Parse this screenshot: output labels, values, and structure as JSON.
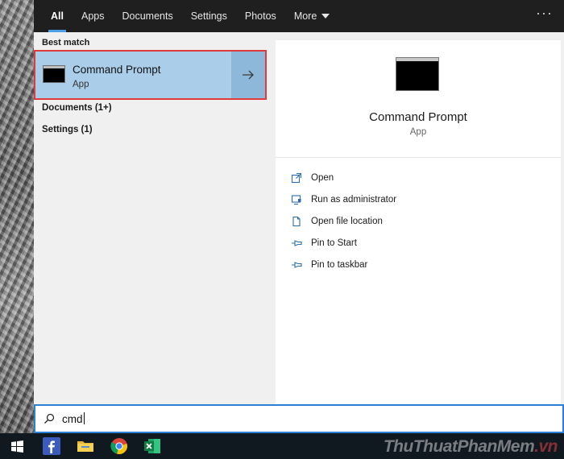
{
  "tabs": [
    {
      "label": "All",
      "active": true
    },
    {
      "label": "Apps",
      "active": false
    },
    {
      "label": "Documents",
      "active": false
    },
    {
      "label": "Settings",
      "active": false
    },
    {
      "label": "Photos",
      "active": false
    },
    {
      "label": "More",
      "active": false,
      "has_dropdown": true
    }
  ],
  "more_options_glyph": "···",
  "results": {
    "best_match_label": "Best match",
    "best_match": {
      "title": "Command Prompt",
      "subtitle": "App",
      "icon": "command-prompt-icon",
      "arrow_icon": "arrow-right-icon"
    },
    "other_groups": [
      {
        "label": "Documents (1+)"
      },
      {
        "label": "Settings (1)"
      }
    ]
  },
  "preview": {
    "title": "Command Prompt",
    "subtitle": "App",
    "icon": "command-prompt-icon",
    "actions": [
      {
        "label": "Open",
        "icon": "open-icon"
      },
      {
        "label": "Run as administrator",
        "icon": "shield-icon"
      },
      {
        "label": "Open file location",
        "icon": "file-location-icon"
      },
      {
        "label": "Pin to Start",
        "icon": "pin-icon"
      },
      {
        "label": "Pin to taskbar",
        "icon": "pin-icon"
      }
    ]
  },
  "search": {
    "value": "cmd",
    "icon": "search-icon"
  },
  "taskbar": {
    "items": [
      {
        "name": "start-button",
        "icon": "windows-icon"
      },
      {
        "name": "facebook",
        "icon": "facebook-icon"
      },
      {
        "name": "file-explorer",
        "icon": "folder-icon"
      },
      {
        "name": "chrome",
        "icon": "chrome-icon"
      },
      {
        "name": "excel",
        "icon": "excel-icon"
      }
    ]
  },
  "watermark": {
    "brand": "ThuThuatPhanMem",
    "tld": ".vn"
  },
  "colors": {
    "tab_bar": "#1f1f1f",
    "active_tab_indicator": "#4a9fe8",
    "selected_item": "#aacde9",
    "highlight_border": "#e03a3a",
    "search_border": "#2b7fd4",
    "taskbar": "#101820"
  }
}
